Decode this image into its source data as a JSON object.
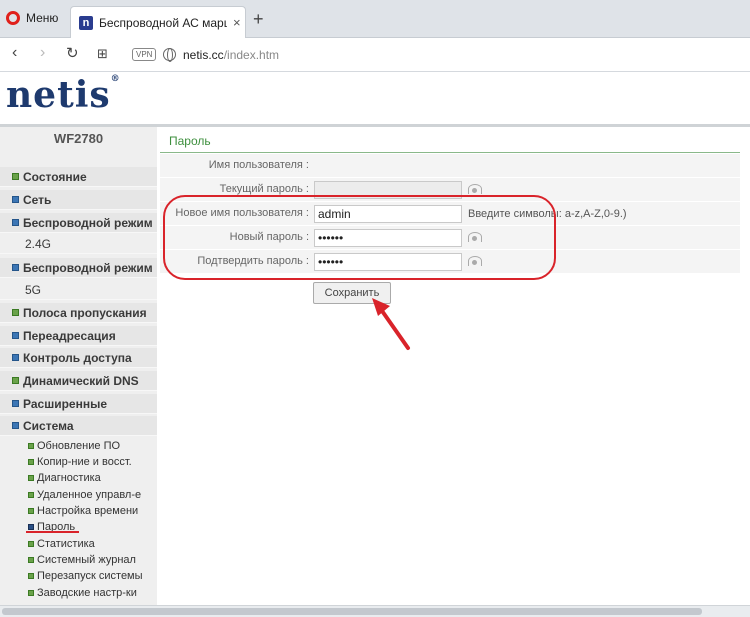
{
  "browser": {
    "menu_label": "Меню",
    "tab_title": "Беспроводной АС маршр",
    "tab_close": "×",
    "new_tab": "+",
    "vpn_label": "VPN",
    "url_host": "netis.cc",
    "url_path": "/index.htm"
  },
  "brand": {
    "logo": "netis",
    "reg_mark": "®"
  },
  "sidebar": {
    "model": "WF2780",
    "items": [
      {
        "label": "Состояние",
        "icon": "green"
      },
      {
        "label": "Сеть",
        "icon": "blue"
      },
      {
        "label": "Беспроводной режим",
        "icon": "blue"
      },
      {
        "label": "2.4G",
        "icon": "none"
      },
      {
        "label": "Беспроводной режим",
        "icon": "blue"
      },
      {
        "label": "5G",
        "icon": "none"
      },
      {
        "label": "Полоса пропускания",
        "icon": "green"
      },
      {
        "label": "Переадресация",
        "icon": "blue"
      },
      {
        "label": "Контроль доступа",
        "icon": "blue"
      },
      {
        "label": "Динамический DNS",
        "icon": "green"
      },
      {
        "label": "Расширенные",
        "icon": "blue"
      },
      {
        "label": "Система",
        "icon": "blue"
      }
    ],
    "sub_items": [
      {
        "label": "Обновление ПО"
      },
      {
        "label": "Копир-ние и восст."
      },
      {
        "label": "Диагностика"
      },
      {
        "label": "Удаленное управл-е"
      },
      {
        "label": "Настройка времени"
      },
      {
        "label": "Пароль"
      },
      {
        "label": "Статистика"
      },
      {
        "label": "Системный журнал"
      },
      {
        "label": "Перезапуск системы"
      },
      {
        "label": "Заводские настр-ки"
      }
    ]
  },
  "main": {
    "title": "Пароль",
    "fields": {
      "username_label": "Имя пользователя :",
      "current_password_label": "Текущий пароль :",
      "new_username_label": "Новое имя пользователя :",
      "new_username_value": "admin",
      "new_username_hint": "Введите символы: a-z,A-Z,0-9.)",
      "new_password_label": "Новый пароль :",
      "new_password_value": "••••••",
      "confirm_password_label": "Подтвердить пароль :",
      "confirm_password_value": "••••••"
    },
    "save_label": "Сохранить"
  },
  "colors": {
    "accent_green": "#3e8f3e",
    "highlight_red": "#d9232a",
    "logo_blue": "#1e3a6e"
  }
}
